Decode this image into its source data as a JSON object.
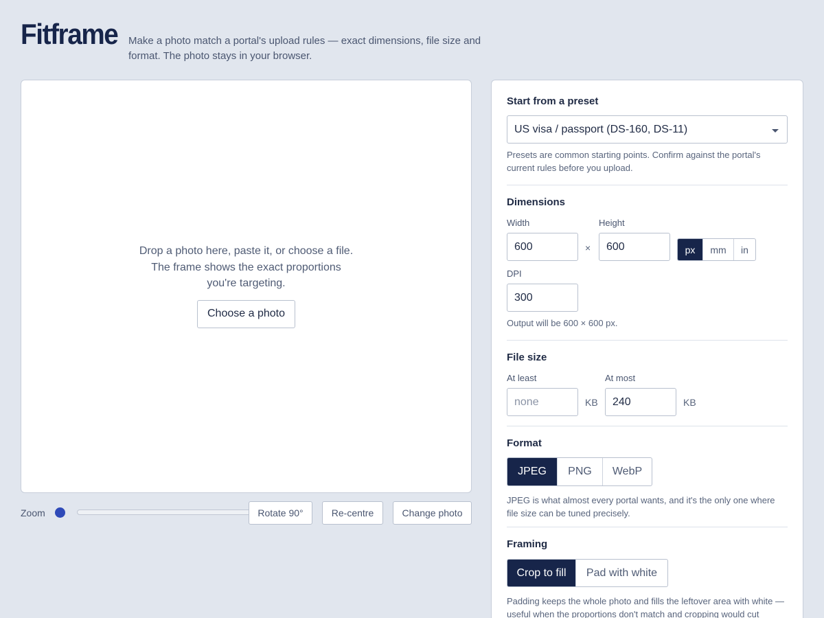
{
  "app": {
    "name": "Fitframe",
    "tagline": "Make a photo match a portal's upload rules — exact dimensions, file size and format. The photo stays in your browser."
  },
  "stage": {
    "drop_text": "Drop a photo here, paste it, or choose a file. The frame shows the exact proportions you're targeting.",
    "choose_label": "Choose a photo"
  },
  "controls": {
    "zoom_label": "Zoom",
    "zoom_value": 0,
    "rotate_label": "Rotate 90°",
    "recentre_label": "Re-centre",
    "change_label": "Change photo"
  },
  "preset": {
    "title": "Start from a preset",
    "selected": "US visa / passport (DS-160, DS-11)",
    "hint": "Presets are common starting points. Confirm against the portal's current rules before you upload."
  },
  "dimensions": {
    "title": "Dimensions",
    "width_label": "Width",
    "width_value": "600",
    "times": "×",
    "height_label": "Height",
    "height_value": "600",
    "units": [
      "px",
      "mm",
      "in"
    ],
    "active_unit": "px",
    "dpi_label": "DPI",
    "dpi_value": "300",
    "output_note": "Output will be 600 × 600 px."
  },
  "filesize": {
    "title": "File size",
    "min_label": "At least",
    "min_placeholder": "none",
    "min_unit": "KB",
    "max_label": "At most",
    "max_value": "240",
    "max_unit": "KB"
  },
  "format": {
    "title": "Format",
    "options": [
      "JPEG",
      "PNG",
      "WebP"
    ],
    "active": "JPEG",
    "hint": "JPEG is what almost every portal wants, and it's the only one where file size can be tuned precisely."
  },
  "framing": {
    "title": "Framing",
    "options": [
      "Crop to fill",
      "Pad with white"
    ],
    "active": "Crop to fill",
    "hint": "Padding keeps the whole photo and fills the leftover area with white — useful when the proportions don't match and cropping would cut"
  },
  "colors": {
    "accent": "#17254a",
    "slider": "#2f4ab8",
    "background": "#e1e6ee"
  }
}
